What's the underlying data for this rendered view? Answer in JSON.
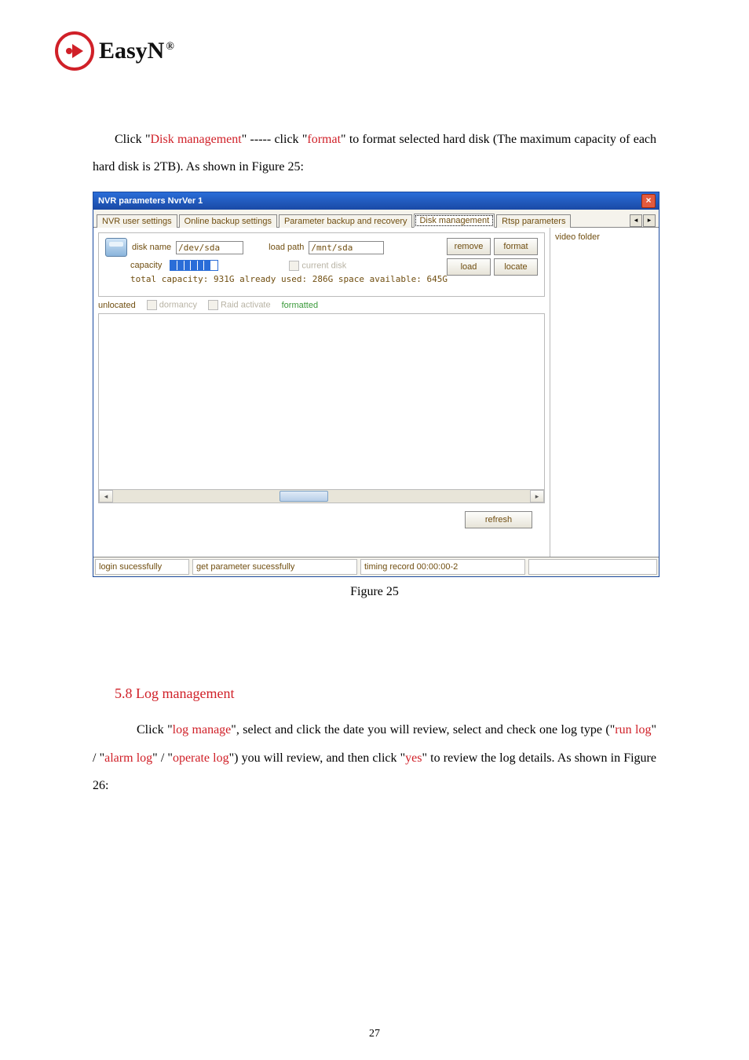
{
  "logo": {
    "brand": "EasyN",
    "reg": "®"
  },
  "para1": {
    "prefix": "Click \"",
    "link1": "Disk management",
    "mid": "\" ----- click \"",
    "link2": "format",
    "suffix": "\" to format selected hard disk (The maximum capacity of each hard disk is 2TB). As shown in Figure 25:"
  },
  "figureCaption": "Figure 25",
  "sectionHeading": "5.8 Log management",
  "para2": {
    "p1": "Click \"",
    "r1": "log manage",
    "p2": "\", select and click the date you will review, select and check one log type (\"",
    "r2": "run log",
    "p3": "\" / \"",
    "r3": "alarm log",
    "p4": "\" / \"",
    "r4": "operate log",
    "p5": "\") you will review, and then click \"",
    "r5": "yes",
    "p6": "\" to review the log details. As shown in Figure 26:"
  },
  "nvr": {
    "title": "NVR parameters NvrVer 1",
    "tabs": {
      "t1": "NVR user settings",
      "t2": "Online backup settings",
      "t3": "Parameter backup and recovery",
      "t4": "Disk management",
      "t5": "Rtsp parameters"
    },
    "side": {
      "videoFolder": "video folder"
    },
    "disk": {
      "name_lbl": "disk name",
      "name_val": "/dev/sda",
      "path_lbl": "load path",
      "path_val": "/mnt/sda",
      "capacity_lbl": "capacity",
      "current_disk": "current disk",
      "totals": "total capacity: 931G already used: 286G space available: 645G",
      "btn_remove": "remove",
      "btn_format": "format",
      "btn_load": "load",
      "btn_locate": "locate"
    },
    "status": {
      "unlocated": "unlocated",
      "dormancy": "dormancy",
      "raid": "Raid activate",
      "formatted": "formatted"
    },
    "refresh": "refresh",
    "bar": {
      "c1": "login sucessfully",
      "c2": "get parameter sucessfully",
      "c3": "timing record 00:00:00-2"
    }
  },
  "pageNumber": "27"
}
